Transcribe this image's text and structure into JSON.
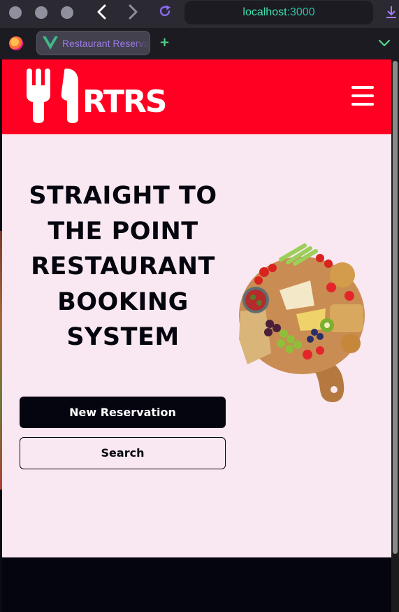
{
  "browser": {
    "url_host": "localhost",
    "url_port": ":3000",
    "tab_title": "Restaurant Reservations",
    "icons": [
      "back-arrow-icon",
      "forward-arrow-icon",
      "reload-icon",
      "download-icon",
      "firefox-icon",
      "vue-icon",
      "new-tab-icon",
      "tab-list-chevron-icon"
    ]
  },
  "header": {
    "logo_text": "RTRS",
    "brand_color": "#ff0022",
    "menu_icon": "hamburger-icon"
  },
  "hero": {
    "title_lines": [
      "STRAIGHT TO",
      "THE POINT",
      "RESTAURANT",
      "BOOKING",
      "SYSTEM"
    ],
    "image": "charcuterie-board-image"
  },
  "actions": {
    "primary_label": "New Reservation",
    "secondary_label": "Search"
  },
  "colors": {
    "page_bg": "#f9e8f1",
    "dark": "#05050f",
    "accent": "#ff0022"
  }
}
